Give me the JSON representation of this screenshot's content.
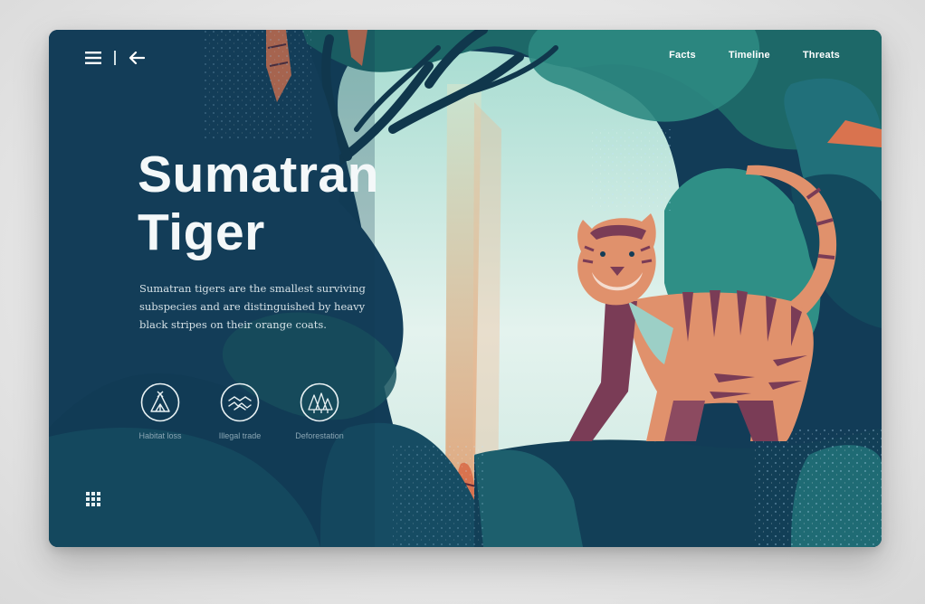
{
  "nav": {
    "menu_icon": "hamburger-menu-icon",
    "back_icon": "arrow-left-icon",
    "links": [
      {
        "label": "Facts"
      },
      {
        "label": "Timeline"
      },
      {
        "label": "Threats"
      }
    ]
  },
  "hero": {
    "title_line1": "Sumatran",
    "title_line2": "Tiger",
    "description": "Sumatran tigers are the smallest surviving subspecies and are distinguished by heavy black stripes on their orange coats."
  },
  "threats": [
    {
      "label": "Habitat loss",
      "icon": "tent-icon"
    },
    {
      "label": "Illegal trade",
      "icon": "hands-icon"
    },
    {
      "label": "Deforestation",
      "icon": "trees-icon"
    }
  ],
  "footer": {
    "grid_icon": "apps-grid-icon"
  },
  "colors": {
    "background": "#123c57",
    "teal": "#1f6f73",
    "mint": "#bfe3d9",
    "tiger_orange": "#e0916c",
    "tiger_purple": "#7a3c56",
    "text": "#f4f8f9"
  }
}
